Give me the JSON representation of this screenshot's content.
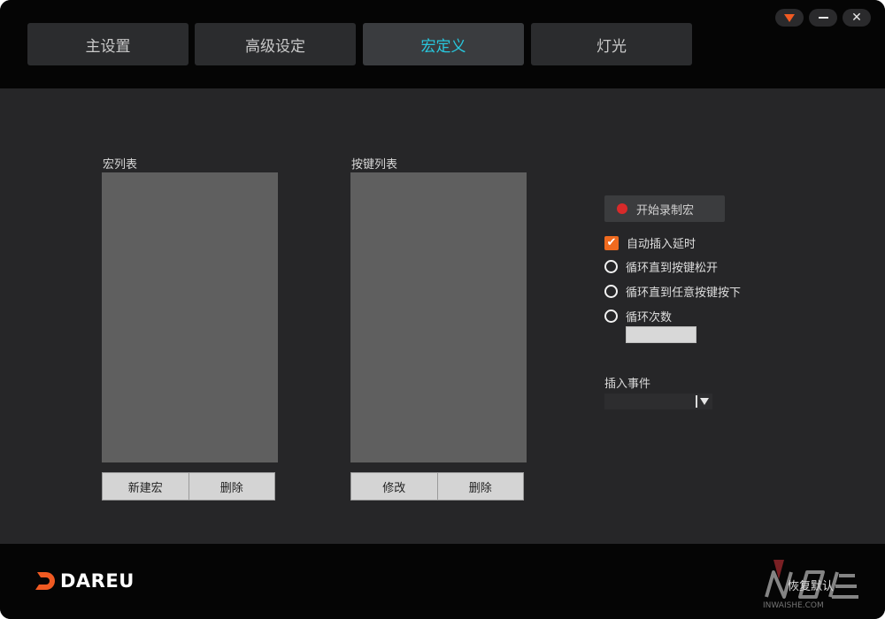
{
  "tabs": [
    {
      "label": "主设置",
      "active": false
    },
    {
      "label": "高级设定",
      "active": false
    },
    {
      "label": "宏定义",
      "active": true
    },
    {
      "label": "灯光",
      "active": false
    }
  ],
  "window_controls": {
    "menu": "dropdown-arrow-icon",
    "minimize": "minus-icon",
    "close": "✕"
  },
  "macro_list": {
    "label": "宏列表",
    "items": [],
    "buttons": {
      "new": "新建宏",
      "delete": "删除"
    }
  },
  "key_list": {
    "label": "按键列表",
    "items": [],
    "buttons": {
      "edit": "修改",
      "delete": "删除"
    }
  },
  "record": {
    "label": "开始录制宏"
  },
  "options": {
    "auto_delay": {
      "label": "自动插入延时",
      "checked": true
    },
    "loop_until_release": {
      "label": "循环直到按键松开",
      "checked": false
    },
    "loop_until_any_key": {
      "label": "循环直到任意按键按下",
      "checked": false
    },
    "loop_count": {
      "label": "循环次数",
      "checked": false,
      "value": ""
    }
  },
  "insert_event": {
    "label": "插入事件",
    "selected": ""
  },
  "footer": {
    "brand": "DAREU",
    "reset": "恢复默认"
  },
  "watermark": {
    "text": "INWAISHE.COM"
  },
  "colors": {
    "accent": "#28c8de",
    "brand": "#f05a22",
    "record": "#d82a2a",
    "checkbox": "#ef6a1f"
  }
}
